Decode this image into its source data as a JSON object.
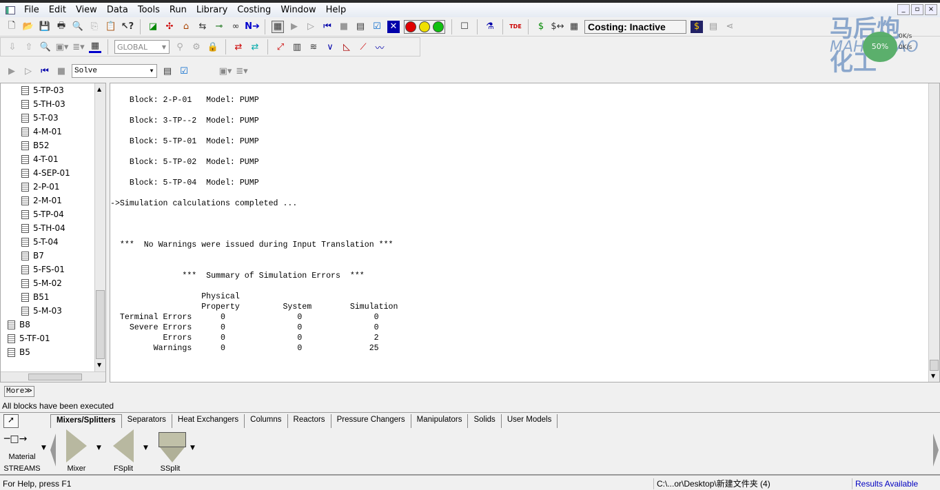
{
  "menu": [
    "File",
    "Edit",
    "View",
    "Data",
    "Tools",
    "Run",
    "Library",
    "Costing",
    "Window",
    "Help"
  ],
  "window_buttons": [
    "_",
    "▫",
    "×"
  ],
  "toolbar": {
    "costing_status": "Costing: Inactive",
    "global_combo": "GLOBAL",
    "solve_combo": "Solve",
    "status_dots": {
      "red": "#e00000",
      "yellow": "#f0e000",
      "green": "#10c010"
    }
  },
  "watermark": {
    "text_cn": "马后炮化工",
    "text_en": "MAHOUPAO",
    "net_up": "0K/s",
    "net_down": "0K/s",
    "badge": "50%"
  },
  "tree": {
    "items": [
      "5-TP-03",
      "5-TH-03",
      "5-T-03",
      "4-M-01",
      "B52",
      "4-T-01",
      "4-SEP-01",
      "2-P-01",
      "2-M-01",
      "5-TP-04",
      "5-TH-04",
      "5-T-04",
      "B7",
      "5-FS-01",
      "5-M-02",
      "B51",
      "5-M-03"
    ],
    "root_items": [
      "B8",
      "5-TF-01",
      "B5"
    ]
  },
  "report": {
    "lines": [
      "    Block: 2-P-01   Model: PUMP",
      "",
      "    Block: 3-TP--2  Model: PUMP",
      "",
      "    Block: 5-TP-01  Model: PUMP",
      "",
      "    Block: 5-TP-02  Model: PUMP",
      "",
      "    Block: 5-TP-04  Model: PUMP",
      "",
      "->Simulation calculations completed ...",
      "",
      "",
      "",
      "  ***  No Warnings were issued during Input Translation ***",
      "",
      "",
      "               ***  Summary of Simulation Errors  ***",
      "",
      "                   Physical",
      "                   Property         System        Simulation",
      "  Terminal Errors      0               0               0",
      "    Severe Errors      0               0               0",
      "           Errors      0               0               2",
      "         Warnings      0               0              25"
    ]
  },
  "more_button": "More",
  "status_message": "All blocks have been executed",
  "palette": {
    "tabs": [
      "Mixers/Splitters",
      "Separators",
      "Heat Exchangers",
      "Columns",
      "Reactors",
      "Pressure Changers",
      "Manipulators",
      "Solids",
      "User Models"
    ],
    "stream_label1": "Material",
    "stream_label2": "STREAMS",
    "models": [
      "Mixer",
      "FSplit",
      "SSplit"
    ]
  },
  "statusbar": {
    "help": "For Help, press F1",
    "path": "C:\\...or\\Desktop\\新建文件夹 (4)",
    "results": "Results Available",
    "results_color": "#0000c0"
  }
}
